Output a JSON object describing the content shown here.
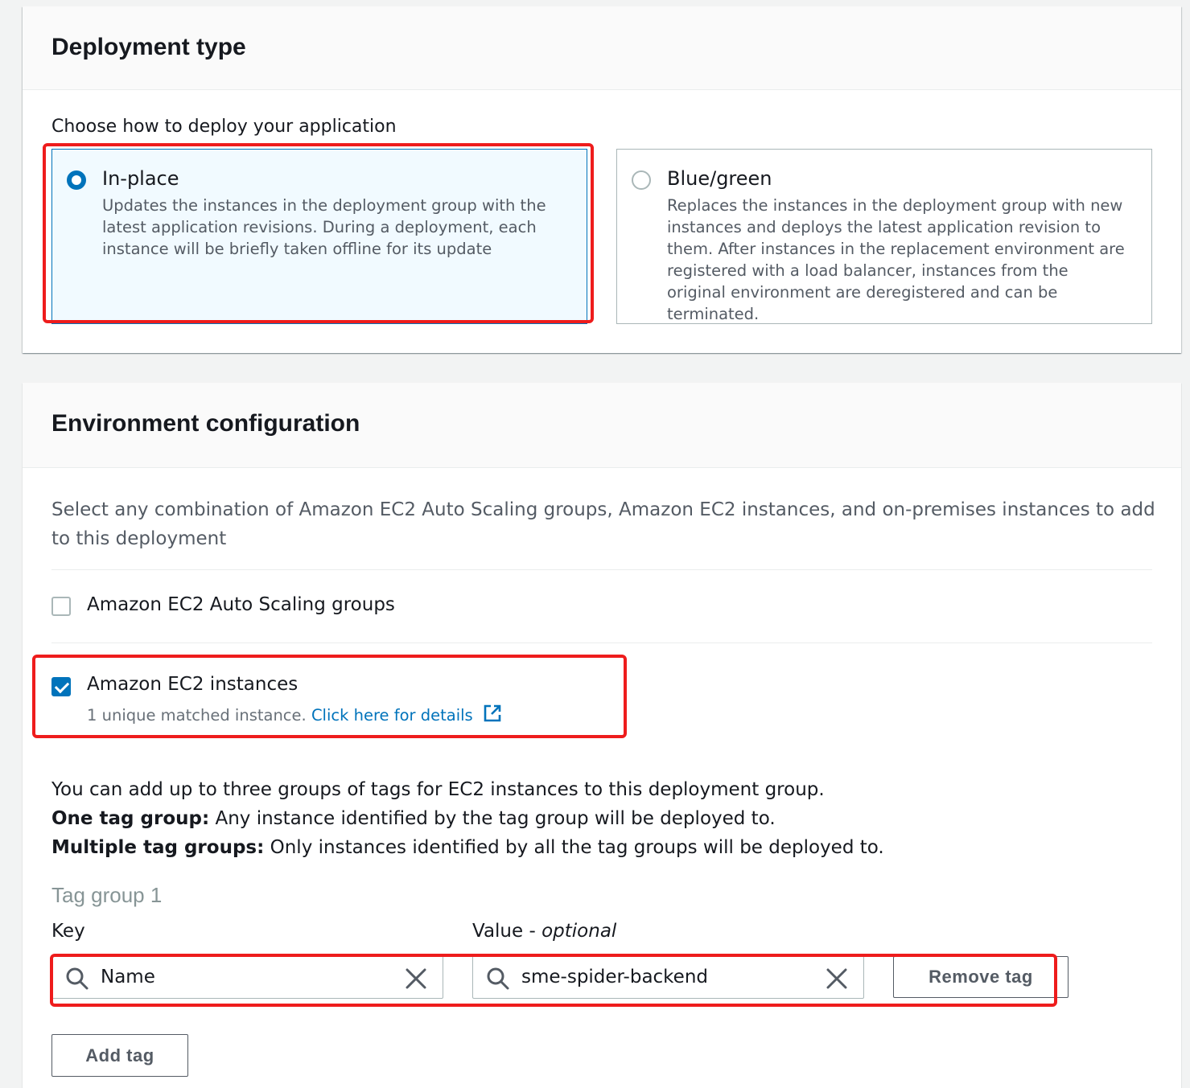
{
  "deployment_type": {
    "title": "Deployment type",
    "prompt": "Choose how to deploy your application",
    "options": [
      {
        "label": "In-place",
        "description": "Updates the instances in the deployment group with the latest application revisions. During a deployment, each instance will be briefly taken offline for its update",
        "selected": true
      },
      {
        "label": "Blue/green",
        "description": "Replaces the instances in the deployment group with new instances and deploys the latest application revision to them. After instances in the replacement environment are registered with a load balancer, instances from the original environment are deregistered and can be terminated.",
        "selected": false
      }
    ]
  },
  "environment": {
    "title": "Environment configuration",
    "description": "Select any combination of Amazon EC2 Auto Scaling groups, Amazon EC2 instances, and on-premises instances to add to this deployment",
    "asg_label": "Amazon EC2 Auto Scaling groups",
    "asg_checked": false,
    "ec2_label": "Amazon EC2 instances",
    "ec2_checked": true,
    "ec2_match_text": "1 unique matched instance.",
    "ec2_details_link": "Click here for details",
    "tags_intro": "You can add up to three groups of tags for EC2 instances to this deployment group.",
    "one_tag_bold": "One tag group:",
    "one_tag_text": " Any instance identified by the tag group will be deployed to.",
    "multi_tag_bold": "Multiple tag groups:",
    "multi_tag_text": " Only instances identified by all the tag groups will be deployed to.",
    "tag_group_label": "Tag group 1",
    "key_label": "Key",
    "value_label": "Value - ",
    "value_optional": "optional",
    "key_value": "Name",
    "value_value": "sme-spider-backend",
    "remove_tag": "Remove tag",
    "add_tag": "Add tag"
  },
  "colors": {
    "accent": "#0073bb",
    "highlight": "#ee1c1c",
    "selected_tile_bg": "#f1faff"
  }
}
